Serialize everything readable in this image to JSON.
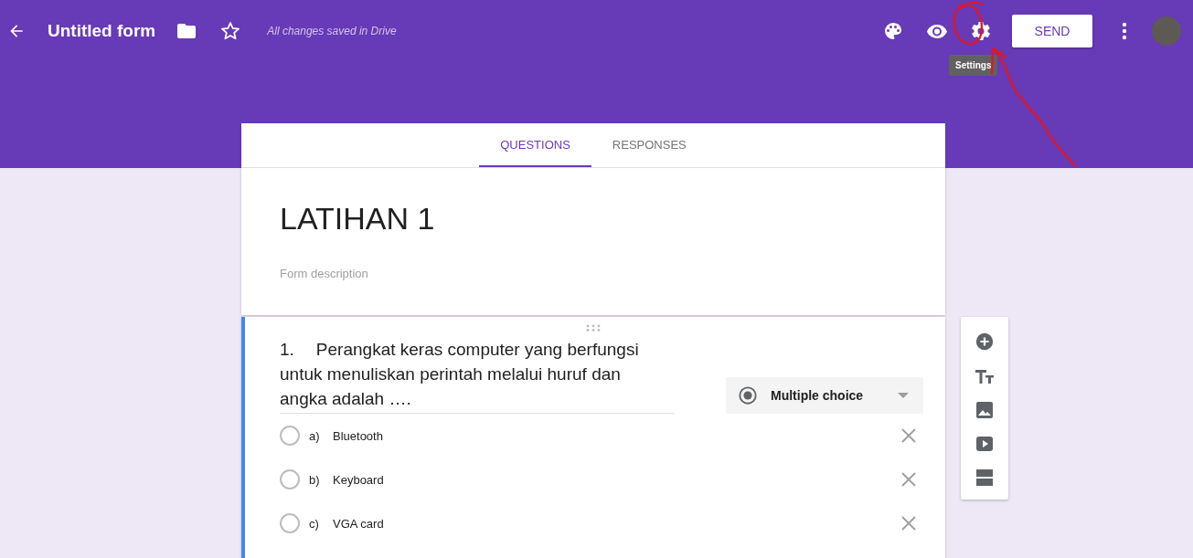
{
  "header": {
    "title": "Untitled form",
    "save_status": "All changes saved in Drive",
    "send_button": "SEND",
    "tooltip": "Settings"
  },
  "tabs": [
    {
      "label": "QUESTIONS",
      "selected": true
    },
    {
      "label": "RESPONSES",
      "selected": false
    }
  ],
  "form": {
    "title": "LATIHAN 1",
    "description_placeholder": "Form description"
  },
  "question": {
    "number": "1.",
    "text": "Perangkat keras computer yang berfungsi untuk menuliskan perintah melalui huruf dan angka adalah ….",
    "type": "Multiple choice",
    "options": [
      {
        "letter": "a)",
        "label": "Bluetooth",
        "selected": false
      },
      {
        "letter": "b)",
        "label": "Keyboard",
        "selected": false
      },
      {
        "letter": "c)",
        "label": "VGA card",
        "selected": false
      }
    ]
  }
}
